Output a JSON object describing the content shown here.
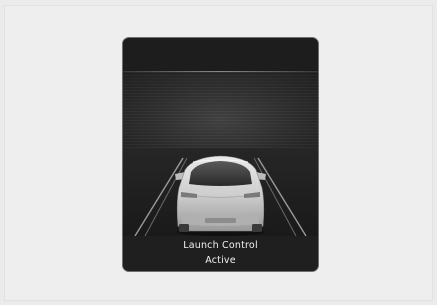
{
  "display": {
    "status_title": "Launch Control",
    "status_value": "Active"
  },
  "icons": {
    "vehicle": "car-rear-icon",
    "lanes": "lane-lines-icon"
  },
  "colors": {
    "page_background": "#ebebeb",
    "screen_background": "#1b1b1b",
    "caption_text": "#f2f2f2"
  }
}
